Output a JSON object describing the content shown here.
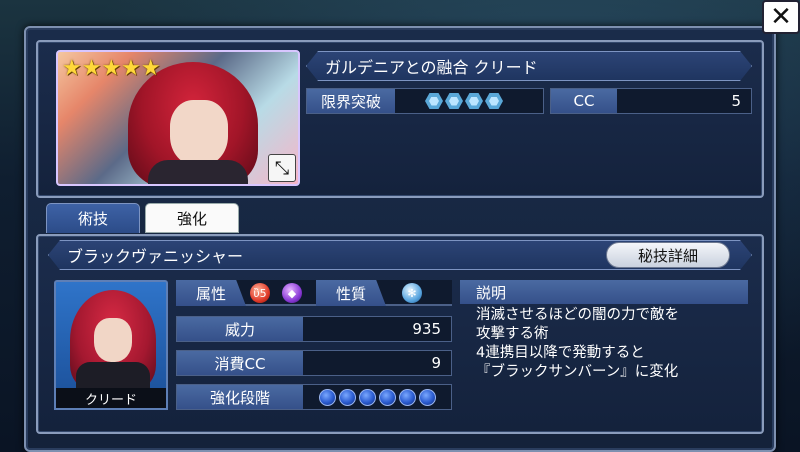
{
  "character": {
    "title": "ガルデニアとの融合 クリード",
    "stars": "★★★★★",
    "name": "クリード"
  },
  "stats": {
    "limit_break_label": "限界突破",
    "limit_break_level": 4,
    "cc_label": "CC",
    "cc_value": "5"
  },
  "tabs": [
    {
      "label": "術技",
      "active": true
    },
    {
      "label": "強化",
      "active": false
    }
  ],
  "skill": {
    "name": "ブラックヴァニッシャー",
    "detail_button": "秘技詳細",
    "attribute_label": "属性",
    "attributes": [
      "fire-icon",
      "dark-icon"
    ],
    "nature_label": "性質",
    "nature": "ice-icon",
    "power_label": "威力",
    "power_value": "935",
    "cost_label": "消費CC",
    "cost_value": "9",
    "level_label": "強化段階",
    "level_dots": 6,
    "description_label": "説明",
    "description_lines": [
      "消滅させるほどの闇の力で敵を",
      "攻撃する術",
      "4連携目以降で発動すると",
      "『ブラックサンバーン』に変化"
    ]
  },
  "colors": {
    "panel_bg": "#1b2c4c",
    "label_bg": "#4a6aa2",
    "accent_border": "#8a9cbc"
  }
}
